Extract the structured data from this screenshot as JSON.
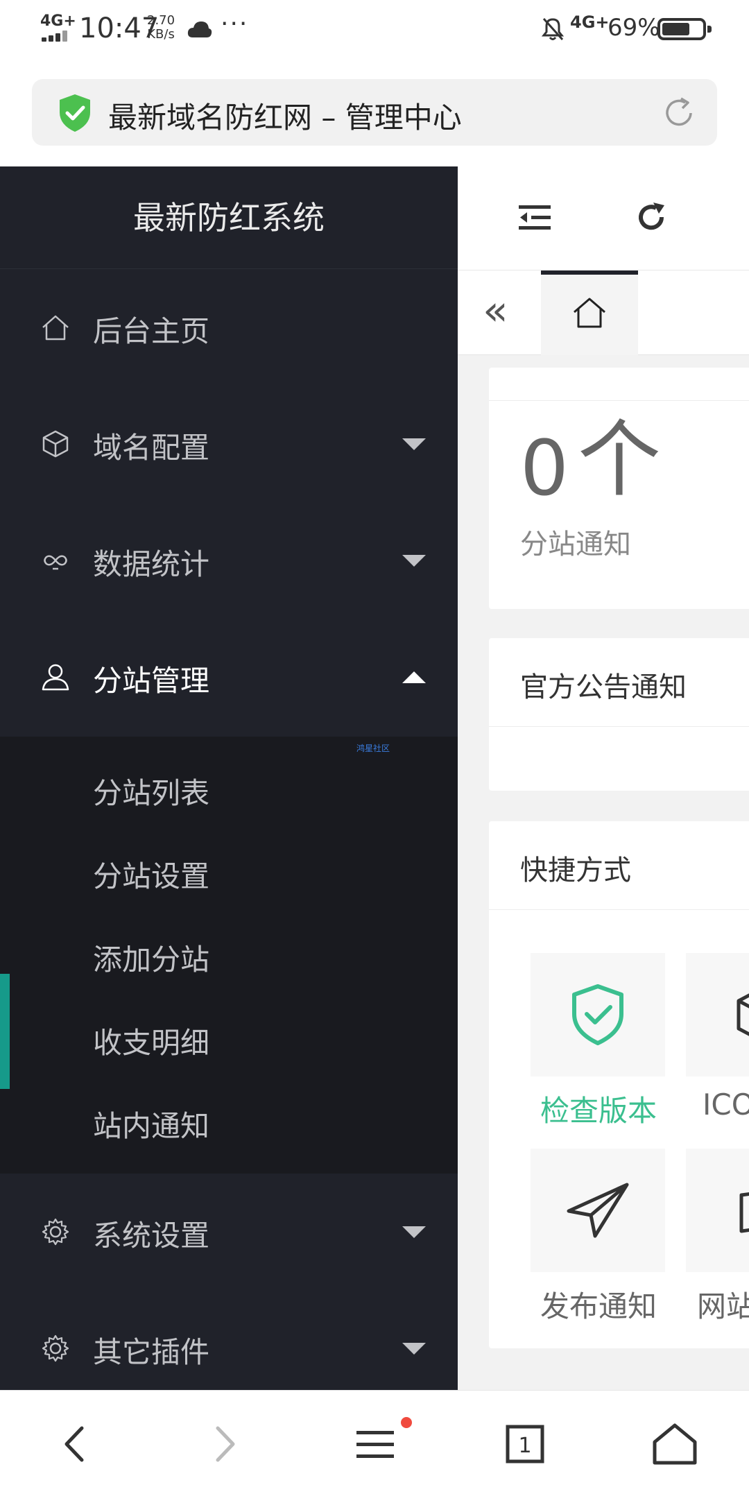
{
  "status_bar": {
    "signal": "4G+",
    "time": "10:47",
    "speed_value": "2.70",
    "speed_unit": "KB/s",
    "more": "···",
    "network": "4G+",
    "battery_percent": "69%",
    "battery_level": 0.69
  },
  "browser": {
    "page_title": "最新域名防红网 – 管理中心"
  },
  "sidebar": {
    "logo": "最新防红系统",
    "items": [
      {
        "label": "后台主页",
        "icon": "home-icon"
      },
      {
        "label": "域名配置",
        "icon": "cube-icon"
      },
      {
        "label": "数据统计",
        "icon": "infinity-icon"
      },
      {
        "label": "分站管理",
        "icon": "user-icon"
      },
      {
        "label": "系统设置",
        "icon": "gear-icon"
      },
      {
        "label": "其它插件",
        "icon": "gear-icon"
      }
    ],
    "submenu_tag": "鸿星社区",
    "submenu": [
      {
        "label": "分站列表"
      },
      {
        "label": "分站设置"
      },
      {
        "label": "添加分站"
      },
      {
        "label": "收支明细"
      },
      {
        "label": "站内通知"
      }
    ]
  },
  "content": {
    "stat": {
      "value": "0",
      "unit": "个",
      "caption": "分站通知"
    },
    "notice_title": "官方公告通知",
    "quick_title": "快捷方式",
    "quick": [
      {
        "label": "检查版本",
        "icon": "shield-check-icon"
      },
      {
        "label": "ICO",
        "icon": "cube-icon"
      },
      {
        "label": "发布通知",
        "icon": "paper-plane-icon"
      },
      {
        "label": "网站",
        "icon": "book-icon"
      }
    ]
  },
  "colors": {
    "sidebar_bg": "#20222a",
    "submenu_bg": "#191a1f",
    "accent": "#3bbf8f",
    "indicator": "#169a8a"
  }
}
